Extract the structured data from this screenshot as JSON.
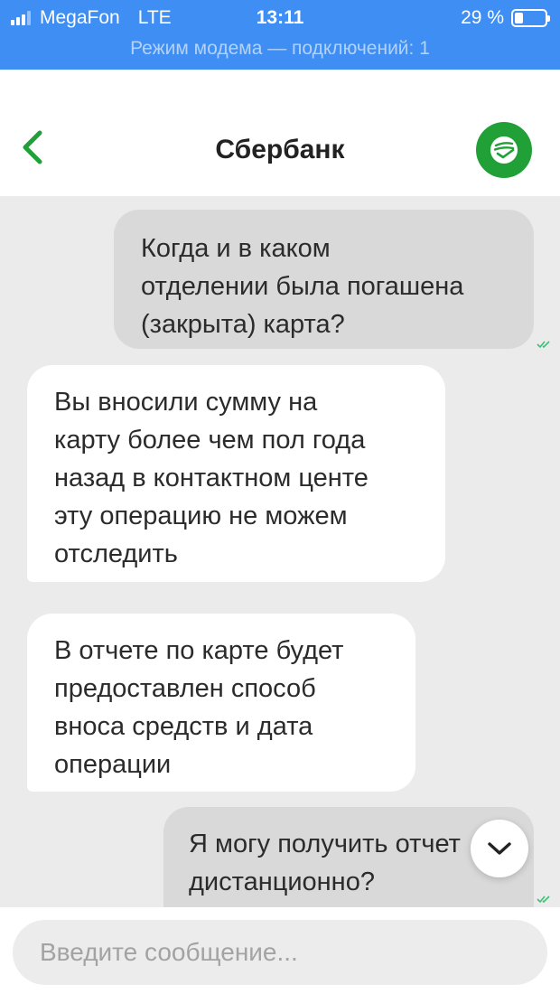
{
  "status_bar": {
    "carrier": "MegaFon",
    "network": "LTE",
    "time": "13:11",
    "battery_text": "29 %",
    "battery_level_percent": 29,
    "hotspot_text": "Режим модема — подключений: 1"
  },
  "header": {
    "title": "Сбербанк",
    "back_icon": "chevron-left-icon",
    "logo_icon": "sberbank-logo-icon",
    "accent_color": "#21a038"
  },
  "messages": [
    {
      "direction": "outgoing",
      "lines": [
        "Когда и в каком",
        "отделении была погашена",
        "(закрыта) карта?"
      ],
      "read": true
    },
    {
      "direction": "incoming",
      "lines": [
        "Вы вносили сумму на",
        "карту более чем пол года",
        "назад в контактном центе",
        "эту операцию не можем",
        "отследить"
      ]
    },
    {
      "direction": "incoming",
      "lines": [
        "В отчете по карте будет",
        "предоставлен способ",
        "вноса средств и дата",
        "операции"
      ]
    },
    {
      "direction": "outgoing",
      "lines": [
        "Я могу получить отчет",
        "дистанционно?"
      ],
      "read": true
    }
  ],
  "scroll_button_icon": "chevron-down-icon",
  "composer": {
    "placeholder": "Введите сообщение..."
  },
  "colors": {
    "status_bar_bg": "#3f8ef3",
    "chat_bg": "#ebebeb",
    "outgoing_bubble": "#d9d9d9",
    "incoming_bubble": "#ffffff",
    "read_check": "#3ac274"
  }
}
